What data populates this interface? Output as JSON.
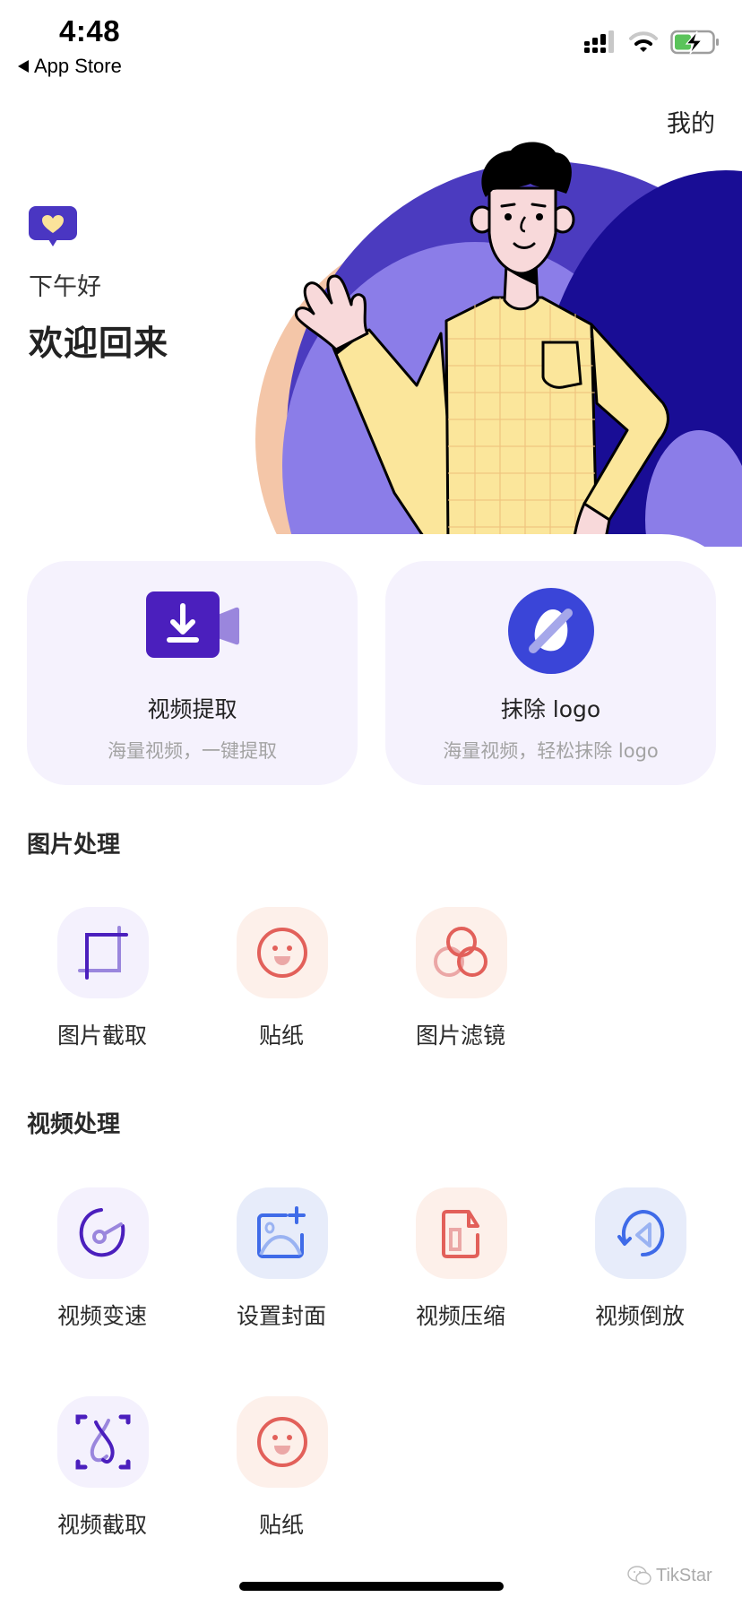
{
  "status_bar": {
    "time": "4:48",
    "back_app": "App Store",
    "icons": [
      "cellular-signal-icon",
      "wifi-icon",
      "battery-charging-icon"
    ]
  },
  "header": {
    "mine_label": "我的"
  },
  "greeting": {
    "icon": "heart-chat-bubble-icon",
    "subtitle": "下午好",
    "title": "欢迎回来"
  },
  "feature_cards": [
    {
      "title": "视频提取",
      "subtitle": "海量视频，一键提取",
      "icon": "video-download-icon"
    },
    {
      "title": "抹除 logo",
      "subtitle": "海量视频，轻松抹除 logo",
      "icon": "erase-logo-icon"
    }
  ],
  "sections": [
    {
      "title": "图片处理",
      "items": [
        {
          "label": "图片截取",
          "icon": "crop-icon"
        },
        {
          "label": "贴纸",
          "icon": "smiley-sticker-icon"
        },
        {
          "label": "图片滤镜",
          "icon": "filter-circles-icon"
        }
      ]
    },
    {
      "title": "视频处理",
      "items": [
        {
          "label": "视频变速",
          "icon": "speed-dial-icon"
        },
        {
          "label": "设置封面",
          "icon": "add-cover-image-icon"
        },
        {
          "label": "视频压缩",
          "icon": "compress-file-icon"
        },
        {
          "label": "视频倒放",
          "icon": "reverse-play-icon"
        },
        {
          "label": "视频截取",
          "icon": "video-cut-icon"
        },
        {
          "label": "贴纸",
          "icon": "smiley-sticker-icon"
        }
      ]
    }
  ],
  "watermark": "TikStar",
  "colors": {
    "accent_purple": "#4b1fbd",
    "accent_blue": "#3a45d8",
    "coral": "#e2605a",
    "card_bg": "#f5f2fd"
  }
}
